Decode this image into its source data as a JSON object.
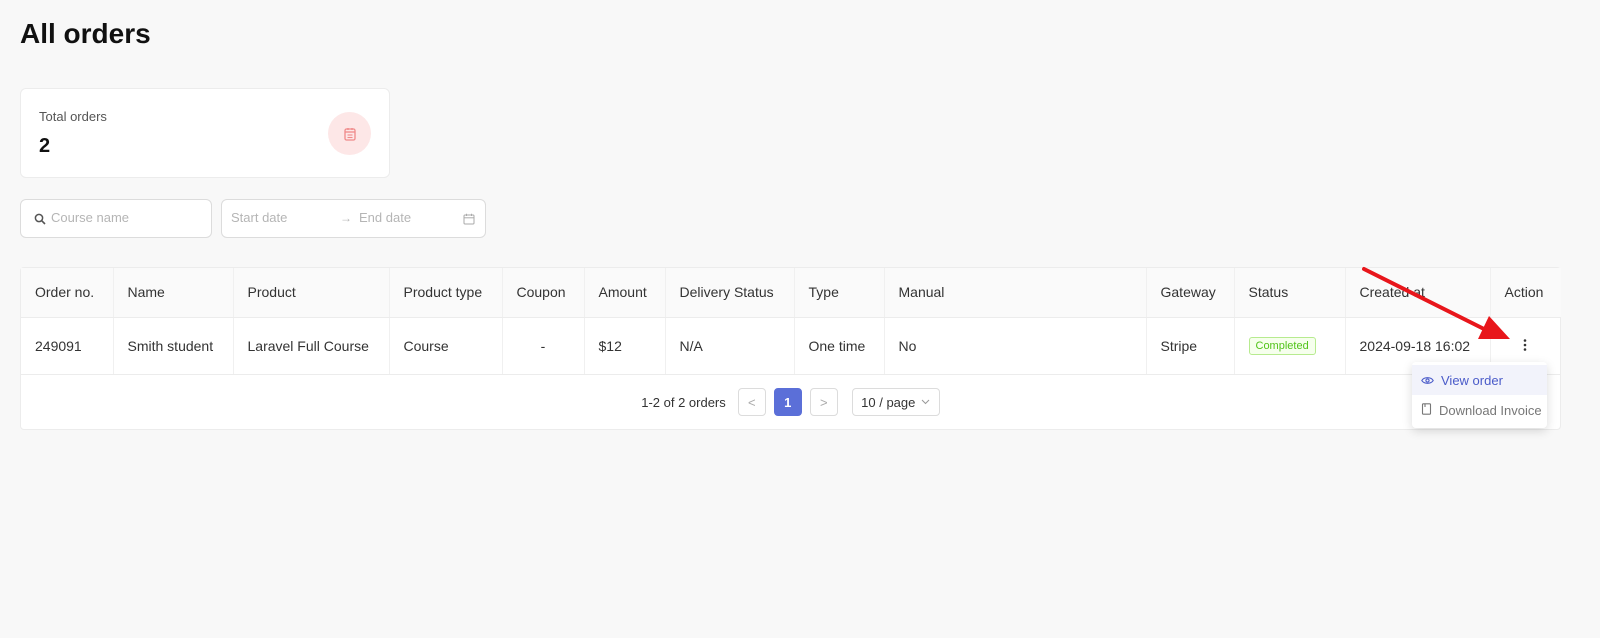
{
  "page": {
    "title": "All orders"
  },
  "stats": {
    "label": "Total orders",
    "value": "2",
    "icon": "calendar-icon"
  },
  "filters": {
    "search_placeholder": "Course name",
    "start_placeholder": "Start date",
    "end_placeholder": "End date",
    "separator": "→"
  },
  "table": {
    "columns": [
      "Order no.",
      "Name",
      "Product",
      "Product type",
      "Coupon",
      "Amount",
      "Delivery Status",
      "Type",
      "Manual",
      "Gateway",
      "Status",
      "Created at",
      "Action"
    ],
    "rows": [
      {
        "order_no": "249091",
        "name": "Smith student",
        "product": "Laravel Full Course",
        "product_type": "Course",
        "coupon": "-",
        "amount": "$12",
        "delivery_status": "N/A",
        "type": "One time",
        "manual": "No",
        "gateway": "Stripe",
        "status": "Completed",
        "created_at": "2024-09-18 16:02"
      }
    ]
  },
  "pagination": {
    "total_text": "1-2 of 2 orders",
    "prev": "<",
    "current": "1",
    "next": ">",
    "page_size": "10 / page"
  },
  "action_menu": {
    "items": [
      {
        "label": "View order",
        "icon": "eye-icon"
      },
      {
        "label": "Download Invoice",
        "icon": "document-icon"
      }
    ]
  },
  "colors": {
    "primary": "#5b6fd8",
    "status_completed": "#52c41a",
    "annotation_arrow": "#e8161b",
    "stat_icon_bg": "#fde7e7"
  }
}
